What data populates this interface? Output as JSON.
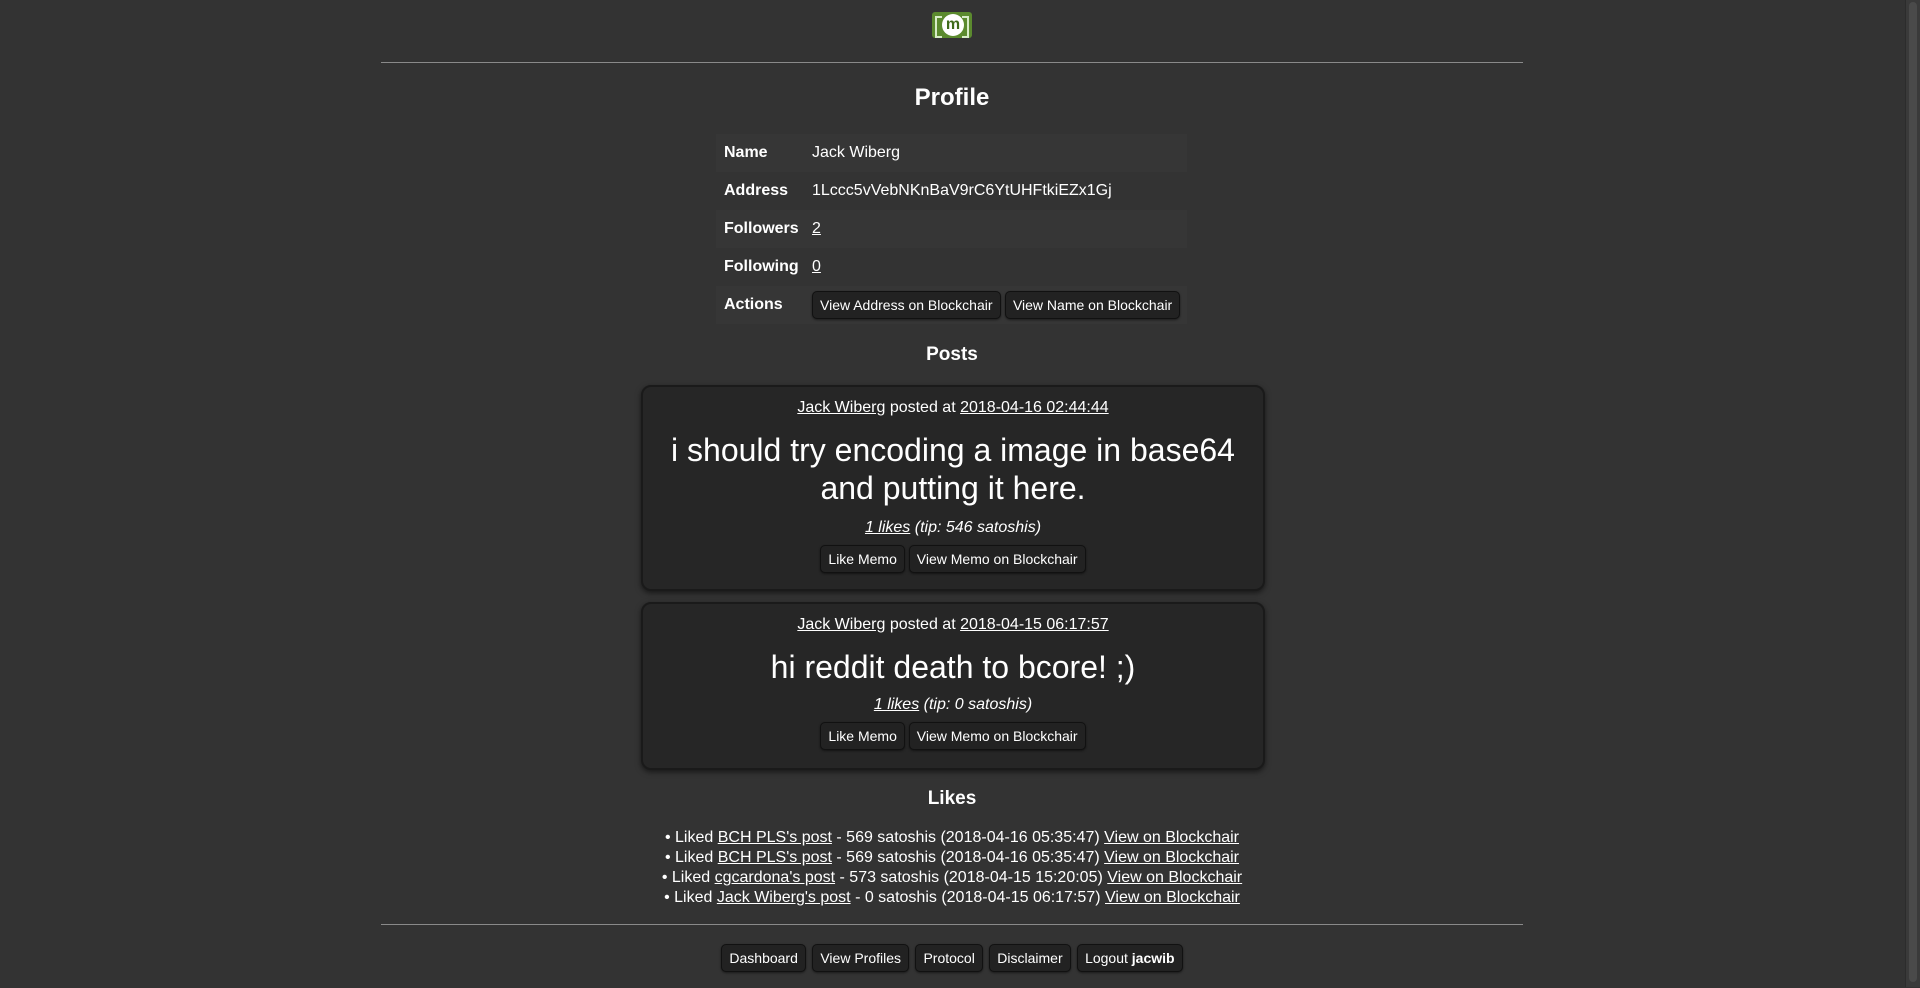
{
  "header": {
    "logo_letter": "m"
  },
  "profile": {
    "title": "Profile",
    "rows": {
      "name_label": "Name",
      "name_value": "Jack Wiberg",
      "address_label": "Address",
      "address_value": "1Lccc5vVebNKnBaV9rC6YtUHFtkiEZx1Gj",
      "followers_label": "Followers",
      "followers_value": "2",
      "following_label": "Following",
      "following_value": "0",
      "actions_label": "Actions"
    },
    "actions": {
      "view_address": "View Address on Blockchair",
      "view_name": "View Name on Blockchair"
    }
  },
  "posts": {
    "title": "Posts",
    "items": [
      {
        "author": "Jack Wiberg",
        "posted_at_text": "posted at",
        "timestamp": "2018-04-16 02:44:44",
        "message": "i should try encoding a image in base64 and putting it here.",
        "likes_link": "1 likes",
        "tip_text": "(tip: 546 satoshis)",
        "like_button": "Like Memo",
        "view_button": "View Memo on Blockchair"
      },
      {
        "author": "Jack Wiberg",
        "posted_at_text": "posted at",
        "timestamp": "2018-04-15 06:17:57",
        "message": "hi reddit death to bcore! ;)",
        "likes_link": "1 likes",
        "tip_text": "(tip: 0 satoshis)",
        "like_button": "Like Memo",
        "view_button": "View Memo on Blockchair"
      }
    ]
  },
  "likes": {
    "title": "Likes",
    "items": [
      {
        "prefix": "Liked",
        "post_link": "BCH PLS's post",
        "detail": "- 569 satoshis (2018-04-16 05:35:47)",
        "view_link": "View on Blockchair"
      },
      {
        "prefix": "Liked",
        "post_link": "BCH PLS's post",
        "detail": "- 569 satoshis (2018-04-16 05:35:47)",
        "view_link": "View on Blockchair"
      },
      {
        "prefix": "Liked",
        "post_link": "cgcardona's post",
        "detail": "- 573 satoshis (2018-04-15 15:20:05)",
        "view_link": "View on Blockchair"
      },
      {
        "prefix": "Liked",
        "post_link": "Jack Wiberg's post",
        "detail": "- 0 satoshis (2018-04-15 06:17:57)",
        "view_link": "View on Blockchair"
      }
    ]
  },
  "footer": {
    "dashboard": "Dashboard",
    "view_profiles": "View Profiles",
    "protocol": "Protocol",
    "disclaimer": "Disclaimer",
    "logout": "Logout",
    "username": "jacwib"
  },
  "colors": {
    "background": "#333333",
    "card": "#262626",
    "logo_green": "#5b8a2e"
  }
}
